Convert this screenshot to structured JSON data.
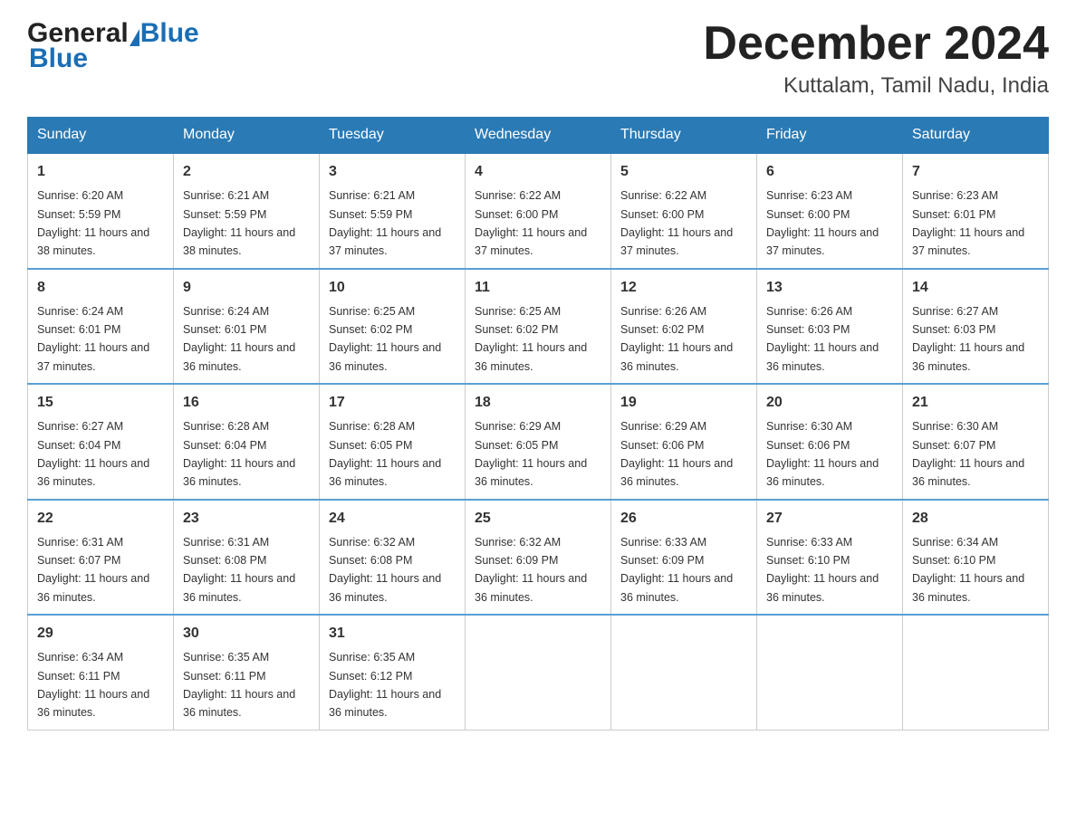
{
  "header": {
    "logo_general": "General",
    "logo_blue": "Blue",
    "month_title": "December 2024",
    "location": "Kuttalam, Tamil Nadu, India"
  },
  "days_of_week": [
    "Sunday",
    "Monday",
    "Tuesday",
    "Wednesday",
    "Thursday",
    "Friday",
    "Saturday"
  ],
  "weeks": [
    [
      {
        "day": "1",
        "sunrise": "6:20 AM",
        "sunset": "5:59 PM",
        "daylight": "11 hours and 38 minutes."
      },
      {
        "day": "2",
        "sunrise": "6:21 AM",
        "sunset": "5:59 PM",
        "daylight": "11 hours and 38 minutes."
      },
      {
        "day": "3",
        "sunrise": "6:21 AM",
        "sunset": "5:59 PM",
        "daylight": "11 hours and 37 minutes."
      },
      {
        "day": "4",
        "sunrise": "6:22 AM",
        "sunset": "6:00 PM",
        "daylight": "11 hours and 37 minutes."
      },
      {
        "day": "5",
        "sunrise": "6:22 AM",
        "sunset": "6:00 PM",
        "daylight": "11 hours and 37 minutes."
      },
      {
        "day": "6",
        "sunrise": "6:23 AM",
        "sunset": "6:00 PM",
        "daylight": "11 hours and 37 minutes."
      },
      {
        "day": "7",
        "sunrise": "6:23 AM",
        "sunset": "6:01 PM",
        "daylight": "11 hours and 37 minutes."
      }
    ],
    [
      {
        "day": "8",
        "sunrise": "6:24 AM",
        "sunset": "6:01 PM",
        "daylight": "11 hours and 37 minutes."
      },
      {
        "day": "9",
        "sunrise": "6:24 AM",
        "sunset": "6:01 PM",
        "daylight": "11 hours and 36 minutes."
      },
      {
        "day": "10",
        "sunrise": "6:25 AM",
        "sunset": "6:02 PM",
        "daylight": "11 hours and 36 minutes."
      },
      {
        "day": "11",
        "sunrise": "6:25 AM",
        "sunset": "6:02 PM",
        "daylight": "11 hours and 36 minutes."
      },
      {
        "day": "12",
        "sunrise": "6:26 AM",
        "sunset": "6:02 PM",
        "daylight": "11 hours and 36 minutes."
      },
      {
        "day": "13",
        "sunrise": "6:26 AM",
        "sunset": "6:03 PM",
        "daylight": "11 hours and 36 minutes."
      },
      {
        "day": "14",
        "sunrise": "6:27 AM",
        "sunset": "6:03 PM",
        "daylight": "11 hours and 36 minutes."
      }
    ],
    [
      {
        "day": "15",
        "sunrise": "6:27 AM",
        "sunset": "6:04 PM",
        "daylight": "11 hours and 36 minutes."
      },
      {
        "day": "16",
        "sunrise": "6:28 AM",
        "sunset": "6:04 PM",
        "daylight": "11 hours and 36 minutes."
      },
      {
        "day": "17",
        "sunrise": "6:28 AM",
        "sunset": "6:05 PM",
        "daylight": "11 hours and 36 minutes."
      },
      {
        "day": "18",
        "sunrise": "6:29 AM",
        "sunset": "6:05 PM",
        "daylight": "11 hours and 36 minutes."
      },
      {
        "day": "19",
        "sunrise": "6:29 AM",
        "sunset": "6:06 PM",
        "daylight": "11 hours and 36 minutes."
      },
      {
        "day": "20",
        "sunrise": "6:30 AM",
        "sunset": "6:06 PM",
        "daylight": "11 hours and 36 minutes."
      },
      {
        "day": "21",
        "sunrise": "6:30 AM",
        "sunset": "6:07 PM",
        "daylight": "11 hours and 36 minutes."
      }
    ],
    [
      {
        "day": "22",
        "sunrise": "6:31 AM",
        "sunset": "6:07 PM",
        "daylight": "11 hours and 36 minutes."
      },
      {
        "day": "23",
        "sunrise": "6:31 AM",
        "sunset": "6:08 PM",
        "daylight": "11 hours and 36 minutes."
      },
      {
        "day": "24",
        "sunrise": "6:32 AM",
        "sunset": "6:08 PM",
        "daylight": "11 hours and 36 minutes."
      },
      {
        "day": "25",
        "sunrise": "6:32 AM",
        "sunset": "6:09 PM",
        "daylight": "11 hours and 36 minutes."
      },
      {
        "day": "26",
        "sunrise": "6:33 AM",
        "sunset": "6:09 PM",
        "daylight": "11 hours and 36 minutes."
      },
      {
        "day": "27",
        "sunrise": "6:33 AM",
        "sunset": "6:10 PM",
        "daylight": "11 hours and 36 minutes."
      },
      {
        "day": "28",
        "sunrise": "6:34 AM",
        "sunset": "6:10 PM",
        "daylight": "11 hours and 36 minutes."
      }
    ],
    [
      {
        "day": "29",
        "sunrise": "6:34 AM",
        "sunset": "6:11 PM",
        "daylight": "11 hours and 36 minutes."
      },
      {
        "day": "30",
        "sunrise": "6:35 AM",
        "sunset": "6:11 PM",
        "daylight": "11 hours and 36 minutes."
      },
      {
        "day": "31",
        "sunrise": "6:35 AM",
        "sunset": "6:12 PM",
        "daylight": "11 hours and 36 minutes."
      },
      null,
      null,
      null,
      null
    ]
  ]
}
